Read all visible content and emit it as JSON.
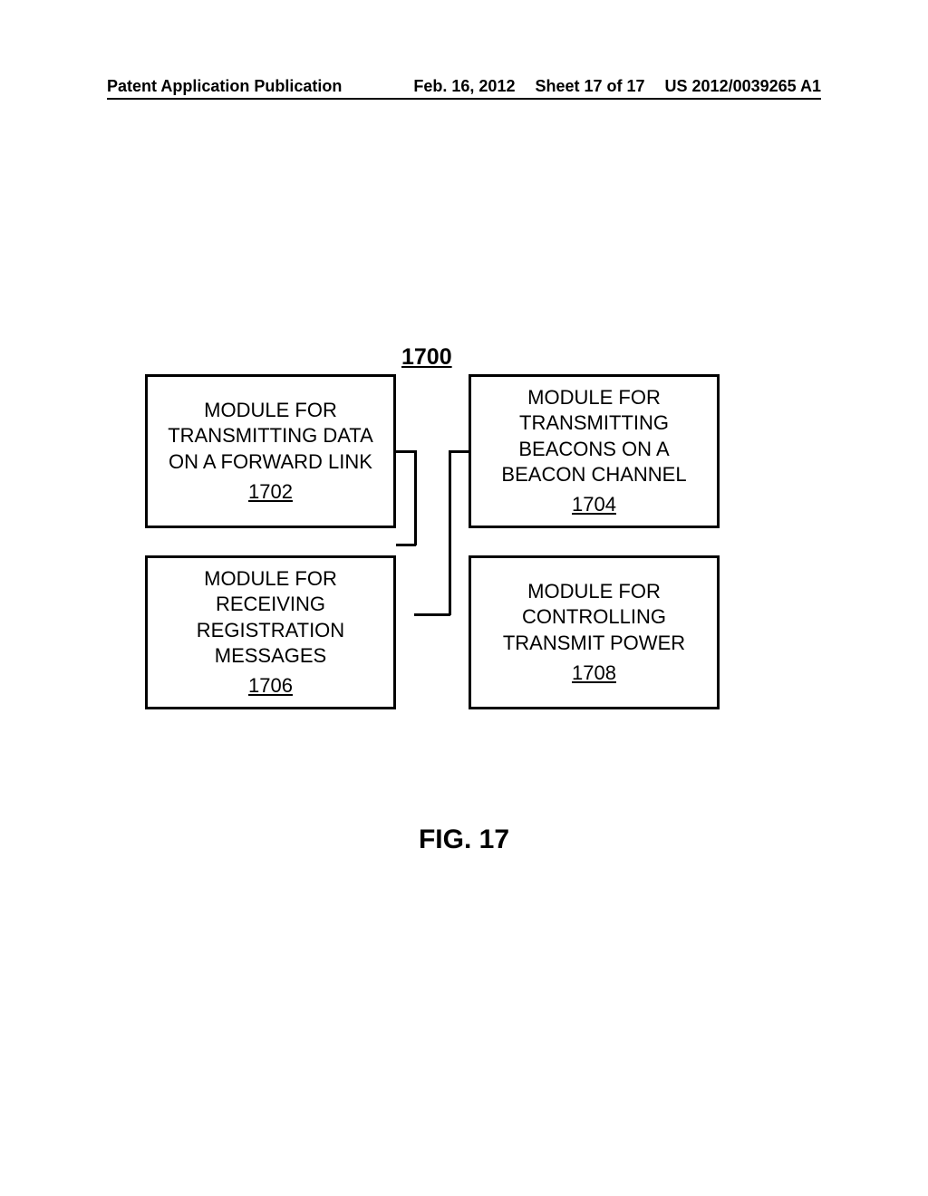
{
  "header": {
    "publication_type": "Patent Application Publication",
    "date": "Feb. 16, 2012",
    "sheet": "Sheet 17 of 17",
    "pub_number": "US 2012/0039265 A1"
  },
  "diagram": {
    "main_ref": "1700",
    "modules": {
      "top_left": {
        "label": "MODULE FOR TRANSMITTING DATA ON A FORWARD LINK",
        "ref": "1702"
      },
      "top_right": {
        "label": "MODULE FOR TRANSMITTING BEACONS ON A BEACON CHANNEL",
        "ref": "1704"
      },
      "bottom_left": {
        "label": "MODULE FOR RECEIVING REGISTRATION MESSAGES",
        "ref": "1706"
      },
      "bottom_right": {
        "label": "MODULE FOR CONTROLLING TRANSMIT POWER",
        "ref": "1708"
      }
    }
  },
  "figure_caption": "FIG. 17"
}
